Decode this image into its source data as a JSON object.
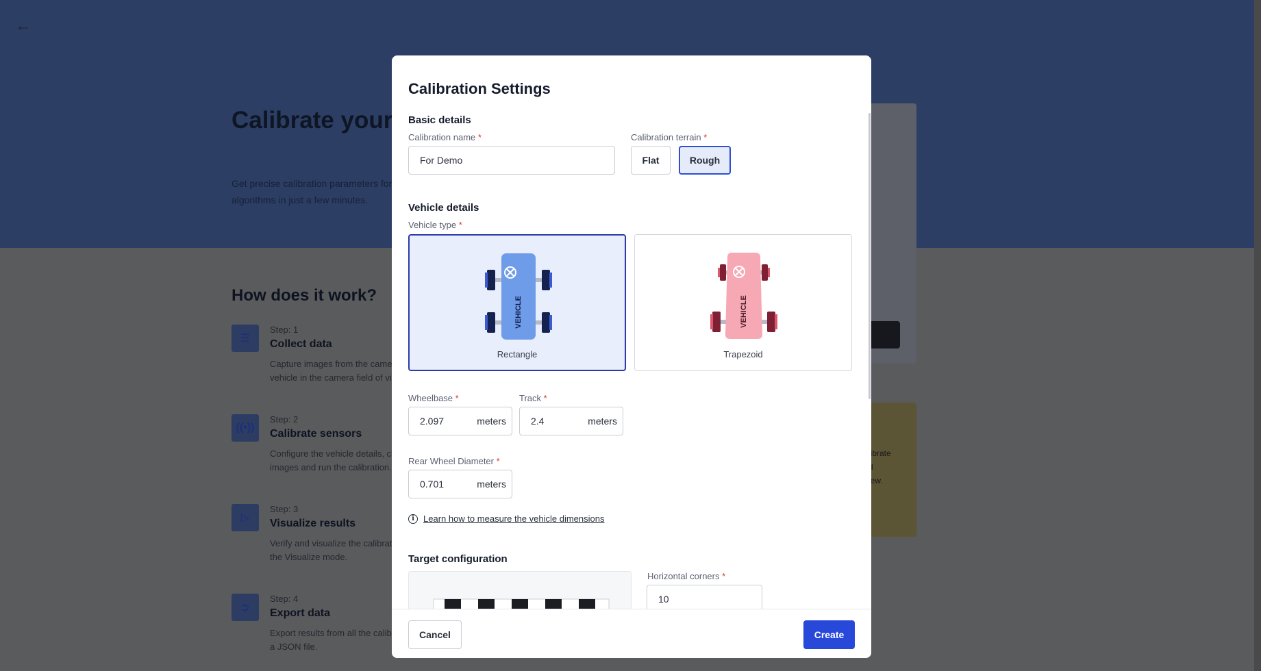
{
  "background": {
    "back_icon": "arrow-left-icon",
    "hero_title": "Calibrate your Vehicle-Camera",
    "hero_subtitle": "Get precise calibration parameters for algorithms in just a few minutes.",
    "how_title": "How does it work?",
    "steps": [
      {
        "num": "Step: 1",
        "title": "Collect data",
        "desc": "Capture images from the camera vehicle in the camera field of vi",
        "icon": "list-icon"
      },
      {
        "num": "Step: 2",
        "title": "Calibrate sensors",
        "desc": "Configure the vehicle details, cl images and run the calibration.",
        "icon": "broadcast-icon"
      },
      {
        "num": "Step: 3",
        "title": "Visualize results",
        "desc": "Verify and visualize the calibrat the Visualize mode.",
        "icon": "play-icon"
      },
      {
        "num": "Step: 4",
        "title": "Export data",
        "desc": "Export results from all the calib to a JSON file.",
        "icon": "export-icon"
      }
    ],
    "yellow_card_text": "librate\nd\niew."
  },
  "modal": {
    "title": "Calibration Settings",
    "basic_details": "Basic details",
    "calibration_name_label": "Calibration name",
    "calibration_name_value": "For Demo",
    "terrain_label": "Calibration terrain",
    "terrain_options": [
      "Flat",
      "Rough"
    ],
    "terrain_selected": "Rough",
    "vehicle_details": "Vehicle details",
    "vehicle_type_label": "Vehicle type",
    "vehicle_types": [
      {
        "label": "Rectangle",
        "selected": true,
        "body_text": "VEHICLE",
        "color": "#6f9ce8"
      },
      {
        "label": "Trapezoid",
        "selected": false,
        "body_text": "VEHICLE",
        "color": "#f7a8b5"
      }
    ],
    "wheelbase_label": "Wheelbase",
    "wheelbase_value": "2.097",
    "track_label": "Track",
    "track_value": "2.4",
    "rear_wheel_label": "Rear Wheel Diameter",
    "rear_wheel_value": "0.701",
    "unit": "meters",
    "required_mark": "*",
    "learn_link": "Learn how to measure the vehicle dimensions",
    "target_configuration": "Target configuration",
    "horizontal_corners_label": "Horizontal corners",
    "horizontal_corners_value": "10",
    "cancel_label": "Cancel",
    "create_label": "Create",
    "accent_color": "#2848d9"
  }
}
